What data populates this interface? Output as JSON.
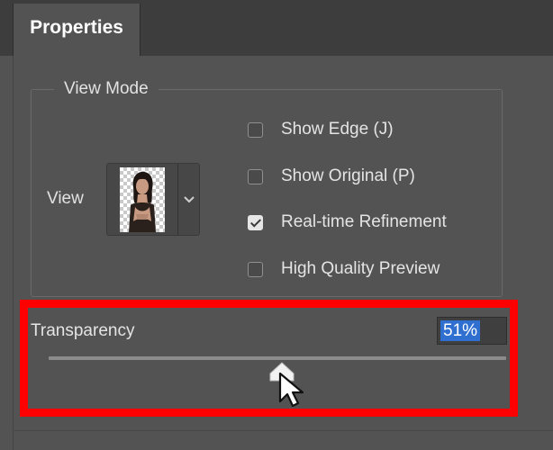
{
  "tab": {
    "label": "Properties"
  },
  "view_mode": {
    "legend": "View Mode",
    "view_label": "View",
    "thumbnail_icon": "cutout-portrait-thumbnail",
    "dropdown_icon": "chevron-down-icon"
  },
  "options": [
    {
      "label": "Show Edge (J)",
      "checked": false
    },
    {
      "label": "Show Original (P)",
      "checked": false
    },
    {
      "label": "Real-time Refinement",
      "checked": true
    },
    {
      "label": "High Quality Preview",
      "checked": false
    }
  ],
  "transparency": {
    "label": "Transparency",
    "value_text": "51%",
    "value_fraction": 0.51
  },
  "colors": {
    "panel_bg": "#535353",
    "tab_bar_bg": "#3d3d3d",
    "selection_blue": "#2f6fd0",
    "highlight_red": "#ff0000"
  }
}
